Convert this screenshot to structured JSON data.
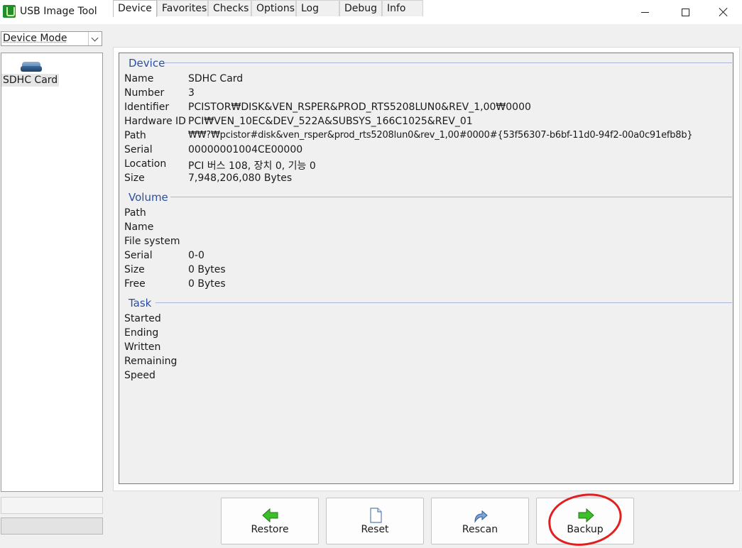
{
  "window": {
    "title": "USB Image Tool"
  },
  "sidebar": {
    "mode_select_value": "Device Mode",
    "devices": [
      {
        "label": "SDHC Card"
      }
    ],
    "progress": 0
  },
  "tabs": [
    {
      "label": "Device",
      "active": true
    },
    {
      "label": "Favorites",
      "active": false
    },
    {
      "label": "Checks",
      "active": false
    },
    {
      "label": "Options",
      "active": false
    },
    {
      "label": "Log",
      "active": false
    },
    {
      "label": "Debug",
      "active": false
    },
    {
      "label": "Info",
      "active": false
    }
  ],
  "device_section": {
    "title": "Device",
    "rows": [
      {
        "label": "Name",
        "value": "SDHC Card"
      },
      {
        "label": "Number",
        "value": "3"
      },
      {
        "label": "Identifier",
        "value": "PCISTOR₩DISK&VEN_RSPER&PROD_RTS5208LUN0&REV_1,00₩0000"
      },
      {
        "label": "Hardware ID",
        "value": "PCI₩VEN_10EC&DEV_522A&SUBSYS_166C1025&REV_01"
      },
      {
        "label": "Path",
        "value": "₩₩?₩pcistor#disk&ven_rsper&prod_rts5208lun0&rev_1,00#0000#{53f56307-b6bf-11d0-94f2-00a0c91efb8b}"
      },
      {
        "label": "Serial",
        "value": "00000001004CE00000"
      },
      {
        "label": "Location",
        "value": "PCI 버스 108, 장치 0, 기능 0"
      },
      {
        "label": "Size",
        "value": "7,948,206,080 Bytes"
      }
    ]
  },
  "volume_section": {
    "title": "Volume",
    "rows": [
      {
        "label": "Path",
        "value": ""
      },
      {
        "label": "Name",
        "value": ""
      },
      {
        "label": "File system",
        "value": ""
      },
      {
        "label": "Serial",
        "value": "0-0"
      },
      {
        "label": "Size",
        "value": "0 Bytes"
      },
      {
        "label": "Free",
        "value": "0 Bytes"
      }
    ]
  },
  "task_section": {
    "title": "Task",
    "rows": [
      {
        "label": "Started",
        "value": ""
      },
      {
        "label": "Ending",
        "value": ""
      },
      {
        "label": "Written",
        "value": ""
      },
      {
        "label": "Remaining",
        "value": ""
      },
      {
        "label": "Speed",
        "value": ""
      }
    ]
  },
  "actions": {
    "restore_label": "Restore",
    "reset_label": "Reset",
    "rescan_label": "Rescan",
    "backup_label": "Backup"
  },
  "icons": {
    "restore": "arrow-left-icon",
    "reset": "document-icon",
    "rescan": "refresh-arrow-icon",
    "backup": "arrow-right-icon"
  },
  "colors": {
    "section_title": "#2a4fa0",
    "arrow_green": "#3cbf2a",
    "annotation_red": "#e02020"
  }
}
